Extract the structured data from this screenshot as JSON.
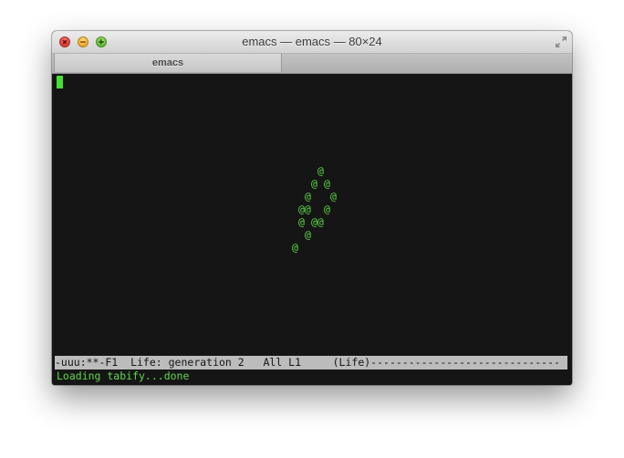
{
  "window": {
    "title": "emacs — emacs — 80×24"
  },
  "tabs": [
    {
      "label": "emacs"
    }
  ],
  "life_cells": [
    {
      "text": "@"
    },
    {
      "text": "@"
    },
    {
      "text": "@"
    },
    {
      "text": "@"
    },
    {
      "text": "@"
    },
    {
      "text": "@@"
    },
    {
      "text": "@"
    },
    {
      "text": "@"
    },
    {
      "text": "@@"
    },
    {
      "text": "@"
    },
    {
      "text": "@"
    }
  ],
  "modeline": {
    "text": "-uuu:**-F1  Life: generation 2   All L1     (Life)------------------------------"
  },
  "echo_area": {
    "text": "Loading tabify...done"
  },
  "colors": {
    "terminal_background": "#151515",
    "terminal_foreground": "#5fd94a",
    "cursor": "#45e033",
    "modeline_background": "#bcbcbc"
  }
}
